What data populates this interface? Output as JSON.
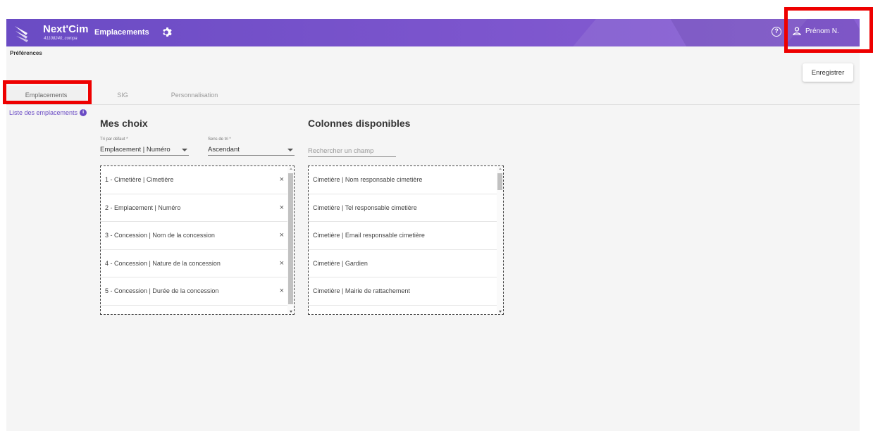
{
  "appbar": {
    "brand": "Next'Cim",
    "brand_sub": "41108240_compa",
    "module": "Emplacements",
    "help_glyph": "?",
    "user_name": "Prénom N."
  },
  "preferences": {
    "title": "Préférences",
    "save_label": "Enregistrer"
  },
  "tabs": [
    {
      "label": "Emplacements",
      "active": true
    },
    {
      "label": "SIG",
      "active": false
    },
    {
      "label": "Personnalisation",
      "active": false
    }
  ],
  "sidebar": {
    "link": "Liste des emplacements",
    "info_glyph": "i"
  },
  "my_choices": {
    "title": "Mes choix",
    "sort_default_label": "Tri par défaut *",
    "sort_default_value": "Emplacement | Numéro",
    "sort_direction_label": "Sens de tri *",
    "sort_direction_value": "Ascendant",
    "remove_glyph": "×",
    "items": [
      "1 - Cimetière | Cimetière",
      "2 - Emplacement | Numéro",
      "3 - Concession | Nom de la concession",
      "4 - Concession | Nature de la concession",
      "5 - Concession | Durée de la concession"
    ]
  },
  "available_columns": {
    "title": "Colonnes disponibles",
    "search_placeholder": "Rechercher un champ",
    "items": [
      "Cimetière | Nom responsable cimetière",
      "Cimetière | Tel responsable cimetière",
      "Cimetière | Email responsable cimetière",
      "Cimetière | Gardien",
      "Cimetière | Mairie de rattachement"
    ]
  },
  "colors": {
    "accent": "#6a4bc4",
    "highlight": "#ee0000"
  },
  "icons": [
    "app-logo-icon",
    "gear-icon",
    "help-icon",
    "user-icon",
    "info-icon",
    "close-icon",
    "dropdown-arrow-icon"
  ]
}
